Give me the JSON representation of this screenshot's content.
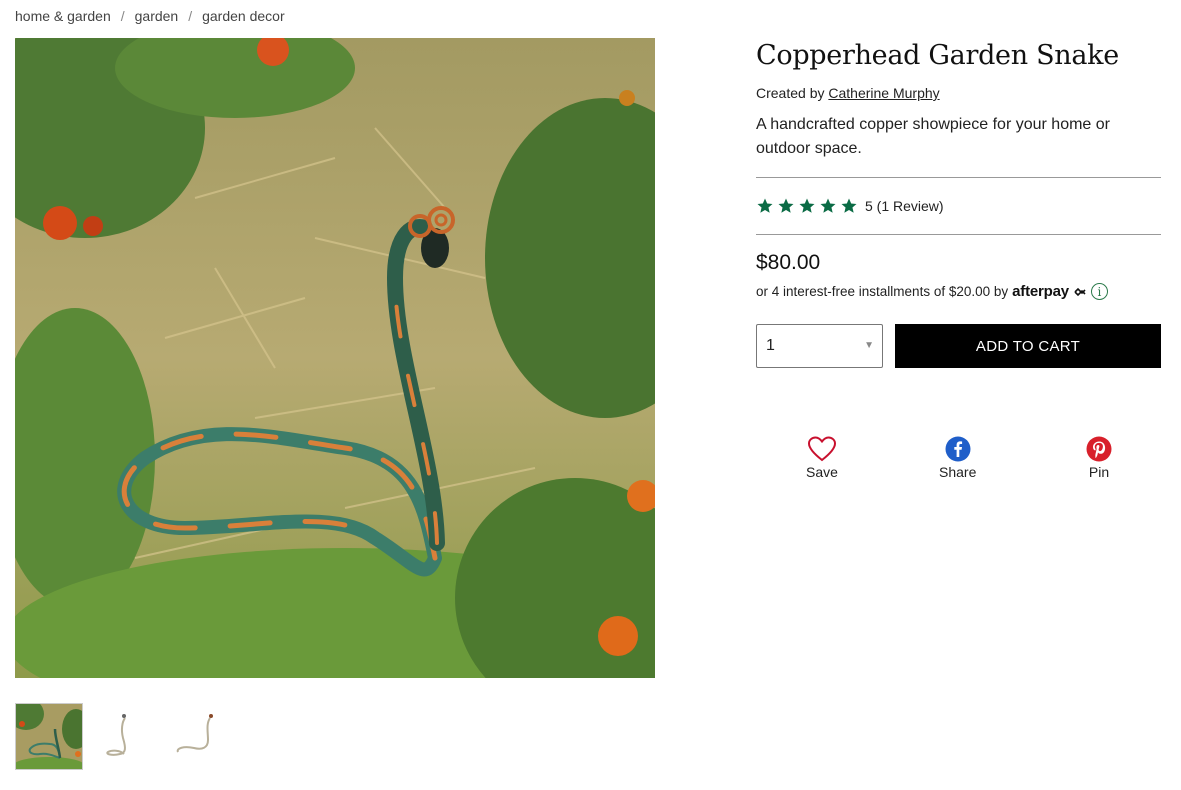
{
  "breadcrumb": [
    "home & garden",
    "garden",
    "garden decor"
  ],
  "product": {
    "title": "Copperhead Garden Snake",
    "created_by_prefix": "Created by",
    "creator": "Catherine Murphy",
    "description": "A handcrafted copper showpiece for your home or outdoor space.",
    "rating_value": 5,
    "rating_text": "5 (1 Review)",
    "price": "$80.00",
    "installments_text": "or 4 interest-free installments of $20.00 by",
    "installments_brand": "afterpay",
    "quantity": "1",
    "add_to_cart_label": "ADD TO CART"
  },
  "social": {
    "save_label": "Save",
    "share_label": "Share",
    "pin_label": "Pin"
  },
  "icons": {
    "star": "star-icon",
    "info": "info-icon",
    "save": "heart-icon",
    "share": "facebook-icon",
    "pin": "pinterest-icon",
    "afterpay_mark": "afterpay-loop-icon"
  },
  "colors": {
    "star": "#0b6b45",
    "button_bg": "#000000",
    "button_text": "#ffffff",
    "heart": "#c8102e",
    "facebook": "#1877f2",
    "pinterest": "#d8202b",
    "info": "#2b7a4b"
  }
}
